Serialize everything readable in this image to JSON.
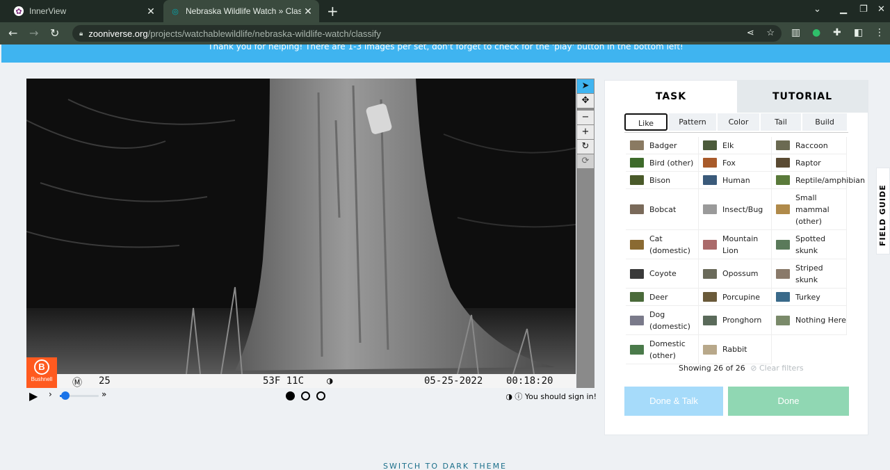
{
  "browser": {
    "tabs": [
      {
        "title": "InnerView",
        "active": false
      },
      {
        "title": "Nebraska Wildlife Watch » Classify",
        "active": true
      }
    ],
    "url_host": "zooniverse.org",
    "url_path": "/projects/watchablewildlife/nebraska-wildlife-watch/classify"
  },
  "banner": {
    "text": "Thank you for helping! There are 1-3 images per set, don't forget to check for the 'play' button in the bottom left!"
  },
  "camera": {
    "brand": "Bushnell",
    "moon": "25",
    "temp": "53F 11C",
    "date": "05-25-2022",
    "time": "00:18:20"
  },
  "viewer": {
    "tools": [
      {
        "name": "pointer-icon",
        "glyph": "➤",
        "active": true
      },
      {
        "name": "move-icon",
        "glyph": "✥",
        "active": false
      },
      {
        "name": "zoom-out-icon",
        "glyph": "−",
        "active": false
      },
      {
        "name": "zoom-in-icon",
        "glyph": "+",
        "active": false
      },
      {
        "name": "rotate-icon",
        "glyph": "↻",
        "active": false
      },
      {
        "name": "reset-icon",
        "glyph": "⟳",
        "active": false
      }
    ],
    "frames": 3,
    "current_frame": 1,
    "signin_text": "You should sign in!"
  },
  "panel": {
    "tab_task": "TASK",
    "tab_tutorial": "TUTORIAL",
    "filters": [
      "Like",
      "Pattern",
      "Color",
      "Tail",
      "Build"
    ],
    "selected_filter": "Like",
    "species": [
      "Badger",
      "Elk",
      "Raccoon",
      "Bird (other)",
      "Fox",
      "Raptor",
      "Bison",
      "Human",
      "Reptile/amphibian",
      "Bobcat",
      "Insect/Bug",
      "Small mammal (other)",
      "Cat (domestic)",
      "Mountain Lion",
      "Spotted skunk",
      "Coyote",
      "Opossum",
      "Striped skunk",
      "Deer",
      "Porcupine",
      "Turkey",
      "Dog (domestic)",
      "Pronghorn",
      "Nothing Here",
      "Domestic (other)",
      "Rabbit"
    ],
    "thumb_colors": [
      "#8a7a62",
      "#4b5a3a",
      "#6b6a52",
      "#3d6a2a",
      "#a85a2a",
      "#5a4a32",
      "#4a5a2a",
      "#3a5a7a",
      "#5a7a3a",
      "#7a6a5a",
      "#9a9a9a",
      "#b08a4a",
      "#8a6a32",
      "#aa6a6a",
      "#5a7a5a",
      "#3a3a3a",
      "#6a6a5a",
      "#8a7a6a",
      "#4a6a3a",
      "#6a5a3a",
      "#3a6a8a",
      "#7a7a8a",
      "#5a6a5a",
      "#7a8a6a",
      "#4a7a4a",
      "#b8a88a"
    ],
    "showing": "Showing 26 of 26",
    "clear_filters": "Clear filters",
    "done_talk": "Done & Talk",
    "done": "Done"
  },
  "field_guide": "FIELD GUIDE",
  "dark_theme": "SWITCH TO DARK THEME"
}
